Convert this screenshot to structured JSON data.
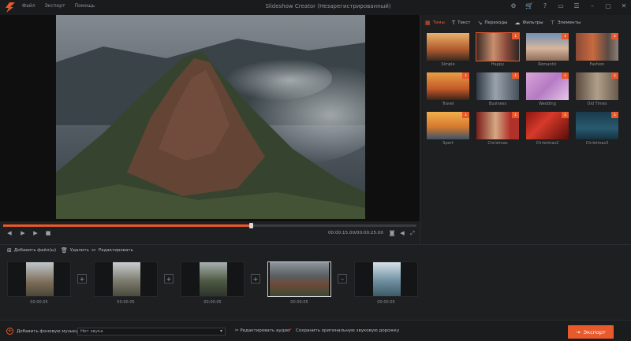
{
  "app": {
    "title": "Slideshow Creator (Незарегистрированный)",
    "menu": [
      "Файл",
      "Экспорт",
      "Помощь"
    ],
    "window_icons": [
      "gear-icon",
      "cart-icon",
      "help-icon",
      "feedback-icon",
      "subtitle-icon",
      "minimize-icon",
      "restore-icon",
      "close-icon"
    ]
  },
  "player": {
    "time": "00:00:15.00/00:00:25.00",
    "progress": 0.6
  },
  "panel": {
    "tabs": [
      {
        "label": "Темы",
        "icon": "themes-icon",
        "active": true
      },
      {
        "label": "Текст",
        "icon": "text-icon",
        "active": false
      },
      {
        "label": "Переходы",
        "icon": "transitions-icon",
        "active": false
      },
      {
        "label": "Фильтры",
        "icon": "filters-icon",
        "active": false
      },
      {
        "label": "Элементы",
        "icon": "elements-icon",
        "active": false
      }
    ],
    "themes": [
      {
        "name": "Simple",
        "download": false
      },
      {
        "name": "Happy",
        "download": true
      },
      {
        "name": "Romantic",
        "download": true
      },
      {
        "name": "Fashion",
        "download": true
      },
      {
        "name": "Travel",
        "download": true
      },
      {
        "name": "Business",
        "download": true
      },
      {
        "name": "Wedding",
        "download": true
      },
      {
        "name": "Old Times",
        "download": true
      },
      {
        "name": "Sport",
        "download": true
      },
      {
        "name": "Christmas",
        "download": true
      },
      {
        "name": "Christmas2",
        "download": true
      },
      {
        "name": "Christmas3",
        "download": true
      }
    ]
  },
  "toolbar": {
    "add_files": "Добавить файл(ы)",
    "delete": "Удалить",
    "edit": "Редактировать"
  },
  "timeline": {
    "clips": [
      {
        "duration": "00:00:05"
      },
      {
        "duration": "00:00:05"
      },
      {
        "duration": "00:00:05"
      },
      {
        "duration": "00:00:05"
      },
      {
        "duration": "00:00:05"
      }
    ]
  },
  "bottom": {
    "add_music": "Добавить фоновую музыку",
    "music_value": "Нет звука",
    "edit_audio": "Редактировать аудио",
    "keep_audio": "Сохранить оригинальную звуковую дорожку",
    "export": "Экспорт"
  },
  "colors": {
    "accent": "#e8592b",
    "background": "#1e1f21"
  }
}
